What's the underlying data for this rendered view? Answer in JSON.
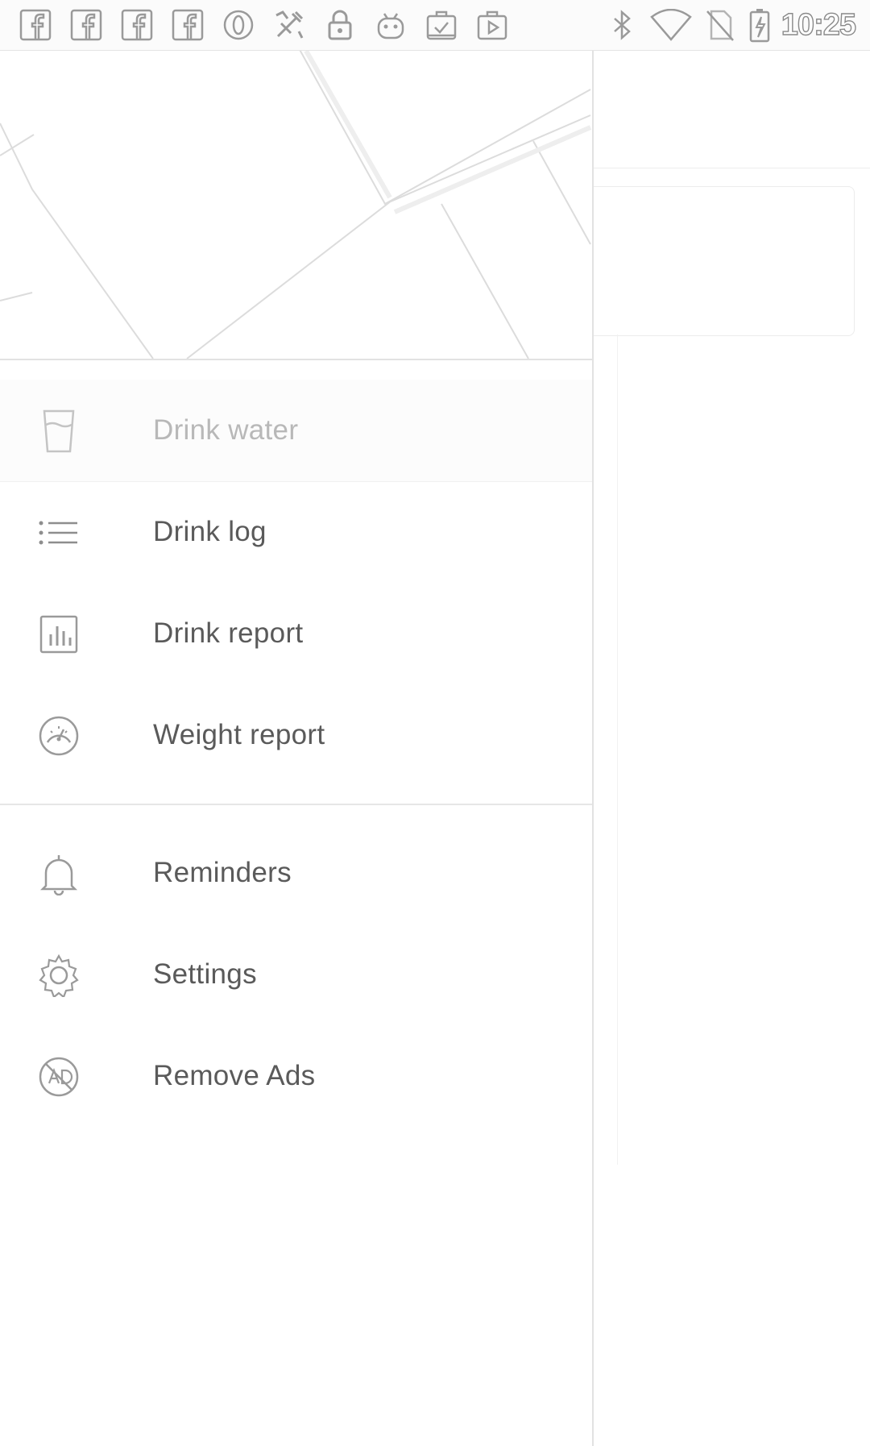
{
  "status_bar": {
    "left_icons": [
      "facebook-icon",
      "facebook-icon",
      "facebook-icon",
      "facebook-icon",
      "opera-icon",
      "no-sim-tools-icon",
      "lock-icon",
      "android-icon",
      "clipboard-check-icon",
      "play-store-icon"
    ],
    "right_icons": [
      "bluetooth-icon",
      "wifi-icon",
      "no-sim-icon",
      "battery-charging-icon"
    ],
    "time": "10:25"
  },
  "drawer": {
    "menu_primary": [
      {
        "label": "Drink water",
        "icon": "glass-icon",
        "active": true
      },
      {
        "label": "Drink log",
        "icon": "list-icon"
      },
      {
        "label": "Drink report",
        "icon": "bar-chart-icon"
      },
      {
        "label": "Weight report",
        "icon": "scale-icon"
      }
    ],
    "menu_secondary": [
      {
        "label": "Reminders",
        "icon": "bell-icon"
      },
      {
        "label": "Settings",
        "icon": "gear-icon"
      },
      {
        "label": "Remove Ads",
        "icon": "no-ads-icon"
      }
    ]
  },
  "colors": {
    "text": "#5a5a5a",
    "text_active": "#b8b8b8",
    "icon": "#9a9a9a",
    "divider": "#e2e2e2"
  }
}
